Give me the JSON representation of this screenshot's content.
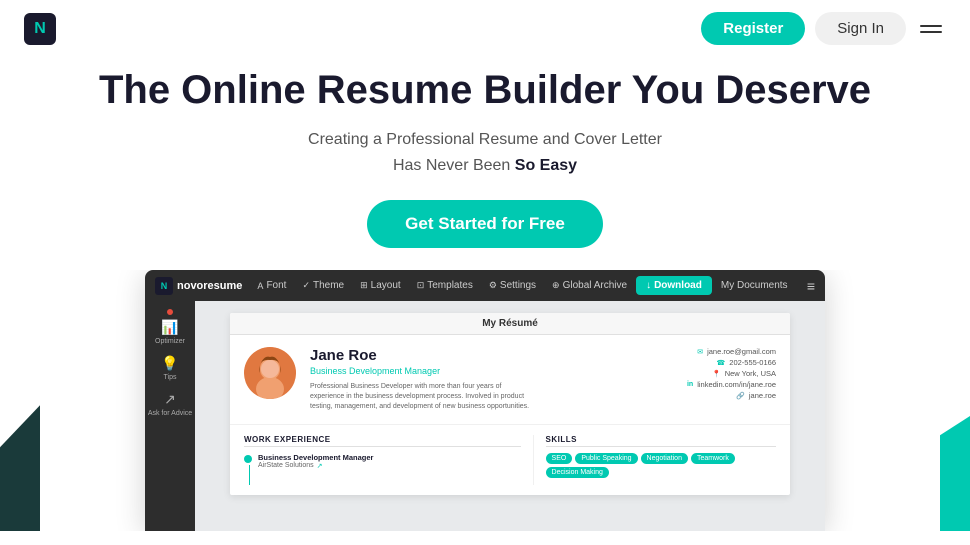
{
  "nav": {
    "logo_letter": "N",
    "register_label": "Register",
    "signin_label": "Sign In"
  },
  "hero": {
    "title": "The Online Resume Builder You Deserve",
    "subtitle_line1": "Creating a Professional Resume and Cover Letter",
    "subtitle_line2": "Has Never Been ",
    "subtitle_emphasis": "So Easy",
    "cta_label": "Get Started for Free"
  },
  "browser_toolbar": {
    "logo_letter": "N",
    "logo_text": "novoresume",
    "nav_items": [
      {
        "label": "Font",
        "icon": "A",
        "active": false
      },
      {
        "label": "Theme",
        "icon": "✓",
        "active": false
      },
      {
        "label": "Layout",
        "icon": "⊞",
        "active": false
      },
      {
        "label": "Templates",
        "icon": "⊡",
        "active": false
      },
      {
        "label": "Settings",
        "icon": "⚙",
        "active": false
      },
      {
        "label": "Global Archive",
        "icon": "⊕",
        "active": false
      },
      {
        "label": "Download",
        "icon": "↓",
        "active": true
      },
      {
        "label": "My Documents",
        "icon": "",
        "active": false
      }
    ]
  },
  "resume": {
    "title": "My Résumé",
    "name": "Jane Roe",
    "role": "Business Development Manager",
    "bio": "Professional Business Developer with more than four years of experience in the business development process. Involved in product testing, management, and development of new business opportunities.",
    "contact": [
      {
        "icon": "✉",
        "value": "jane.roe@gmail.com"
      },
      {
        "icon": "📞",
        "value": "202-555-0166"
      },
      {
        "icon": "📍",
        "value": "New York, USA"
      },
      {
        "icon": "in",
        "value": "linkedin.com/in/jane.roe"
      },
      {
        "icon": "🔗",
        "value": "jane.roe"
      }
    ],
    "work_experience": {
      "section_title": "WORK EXPERIENCE",
      "items": [
        {
          "title": "Business Development Manager",
          "company": "AirState Solutions"
        }
      ]
    },
    "skills": {
      "section_title": "SKILLS",
      "tags": [
        "SEO",
        "Public Speaking",
        "Negotiation",
        "Teamwork",
        "Decision Making"
      ]
    }
  },
  "sidebar_icons": [
    {
      "label": "Optimizer",
      "icon": "📊"
    },
    {
      "label": "Tips",
      "icon": "💡"
    },
    {
      "label": "Ask for Advice",
      "icon": "↗"
    }
  ]
}
